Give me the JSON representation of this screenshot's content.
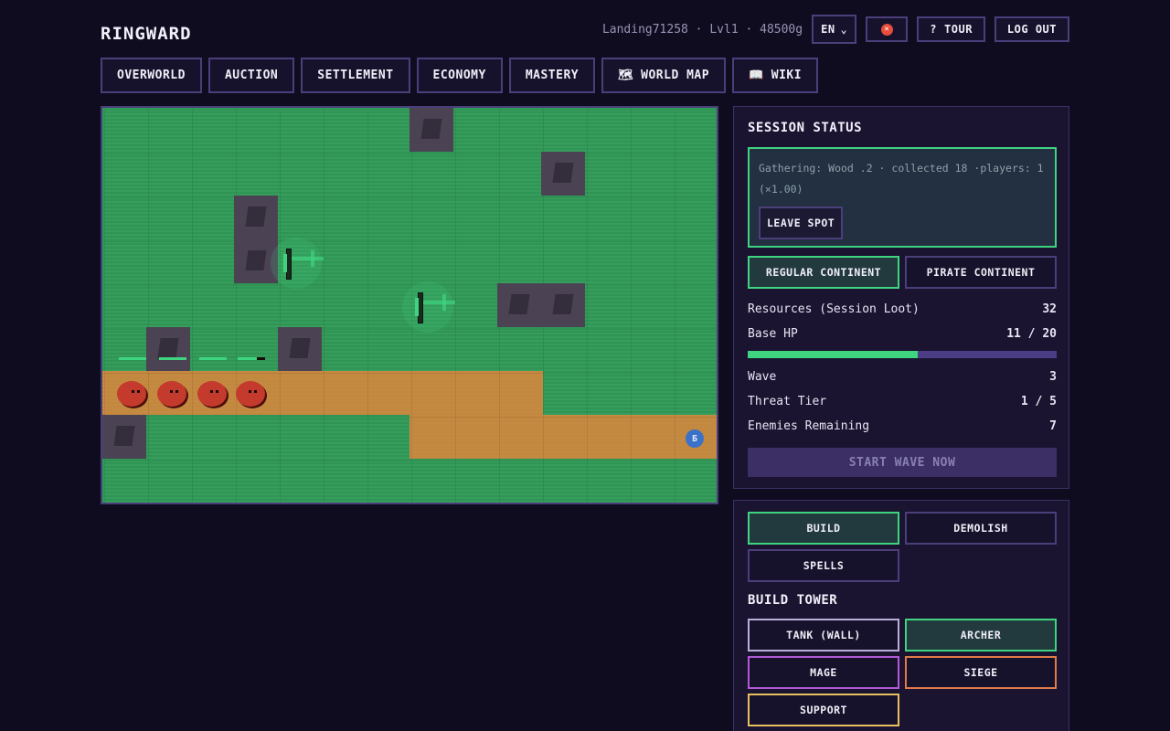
{
  "app": {
    "title": "RINGWARD"
  },
  "user": {
    "info": "Landing71258 · Lvl1 · 48500g",
    "language": "EN",
    "tour_label": "TOUR",
    "logout_label": "LOG OUT"
  },
  "nav": {
    "items": [
      {
        "label": "OVERWORLD"
      },
      {
        "label": "AUCTION"
      },
      {
        "label": "SETTLEMENT"
      },
      {
        "label": "ECONOMY"
      },
      {
        "label": "MASTERY"
      },
      {
        "label": "WORLD MAP",
        "icon": "map-icon"
      },
      {
        "label": "WIKI",
        "icon": "book-icon"
      }
    ]
  },
  "map": {
    "base_label": "Б"
  },
  "session": {
    "title": "SESSION STATUS",
    "gathering_text": "Gathering: Wood .2 · collected 18 ·players: 1 (×1.00)",
    "leave_label": "LEAVE SPOT",
    "regular_continent": "REGULAR CONTINENT",
    "pirate_continent": "PIRATE CONTINENT",
    "resources_label": "Resources (Session Loot)",
    "resources_value": "32",
    "base_hp_label": "Base HP",
    "base_hp_value": "11 / 20",
    "base_hp_fraction": 0.55,
    "wave_label": "Wave",
    "wave_value": "3",
    "threat_label": "Threat Tier",
    "threat_value": "1 / 5",
    "enemies_label": "Enemies Remaining",
    "enemies_value": "7",
    "start_wave_label": "START WAVE NOW"
  },
  "build": {
    "tabs": [
      "BUILD",
      "DEMOLISH",
      "SPELLS"
    ],
    "section_title": "BUILD TOWER",
    "towers": [
      {
        "label": "TANK (WALL)",
        "color": "#b8b0d8"
      },
      {
        "label": "ARCHER",
        "color": "#3fd480"
      },
      {
        "label": "MAGE",
        "color": "#b25ad6"
      },
      {
        "label": "SIEGE",
        "color": "#e07a4a"
      },
      {
        "label": "SUPPORT",
        "color": "#e8c060"
      }
    ]
  },
  "colors": {
    "accent": "#3fd480",
    "panel_border": "#4a3f7a",
    "background": "#100c1f"
  }
}
